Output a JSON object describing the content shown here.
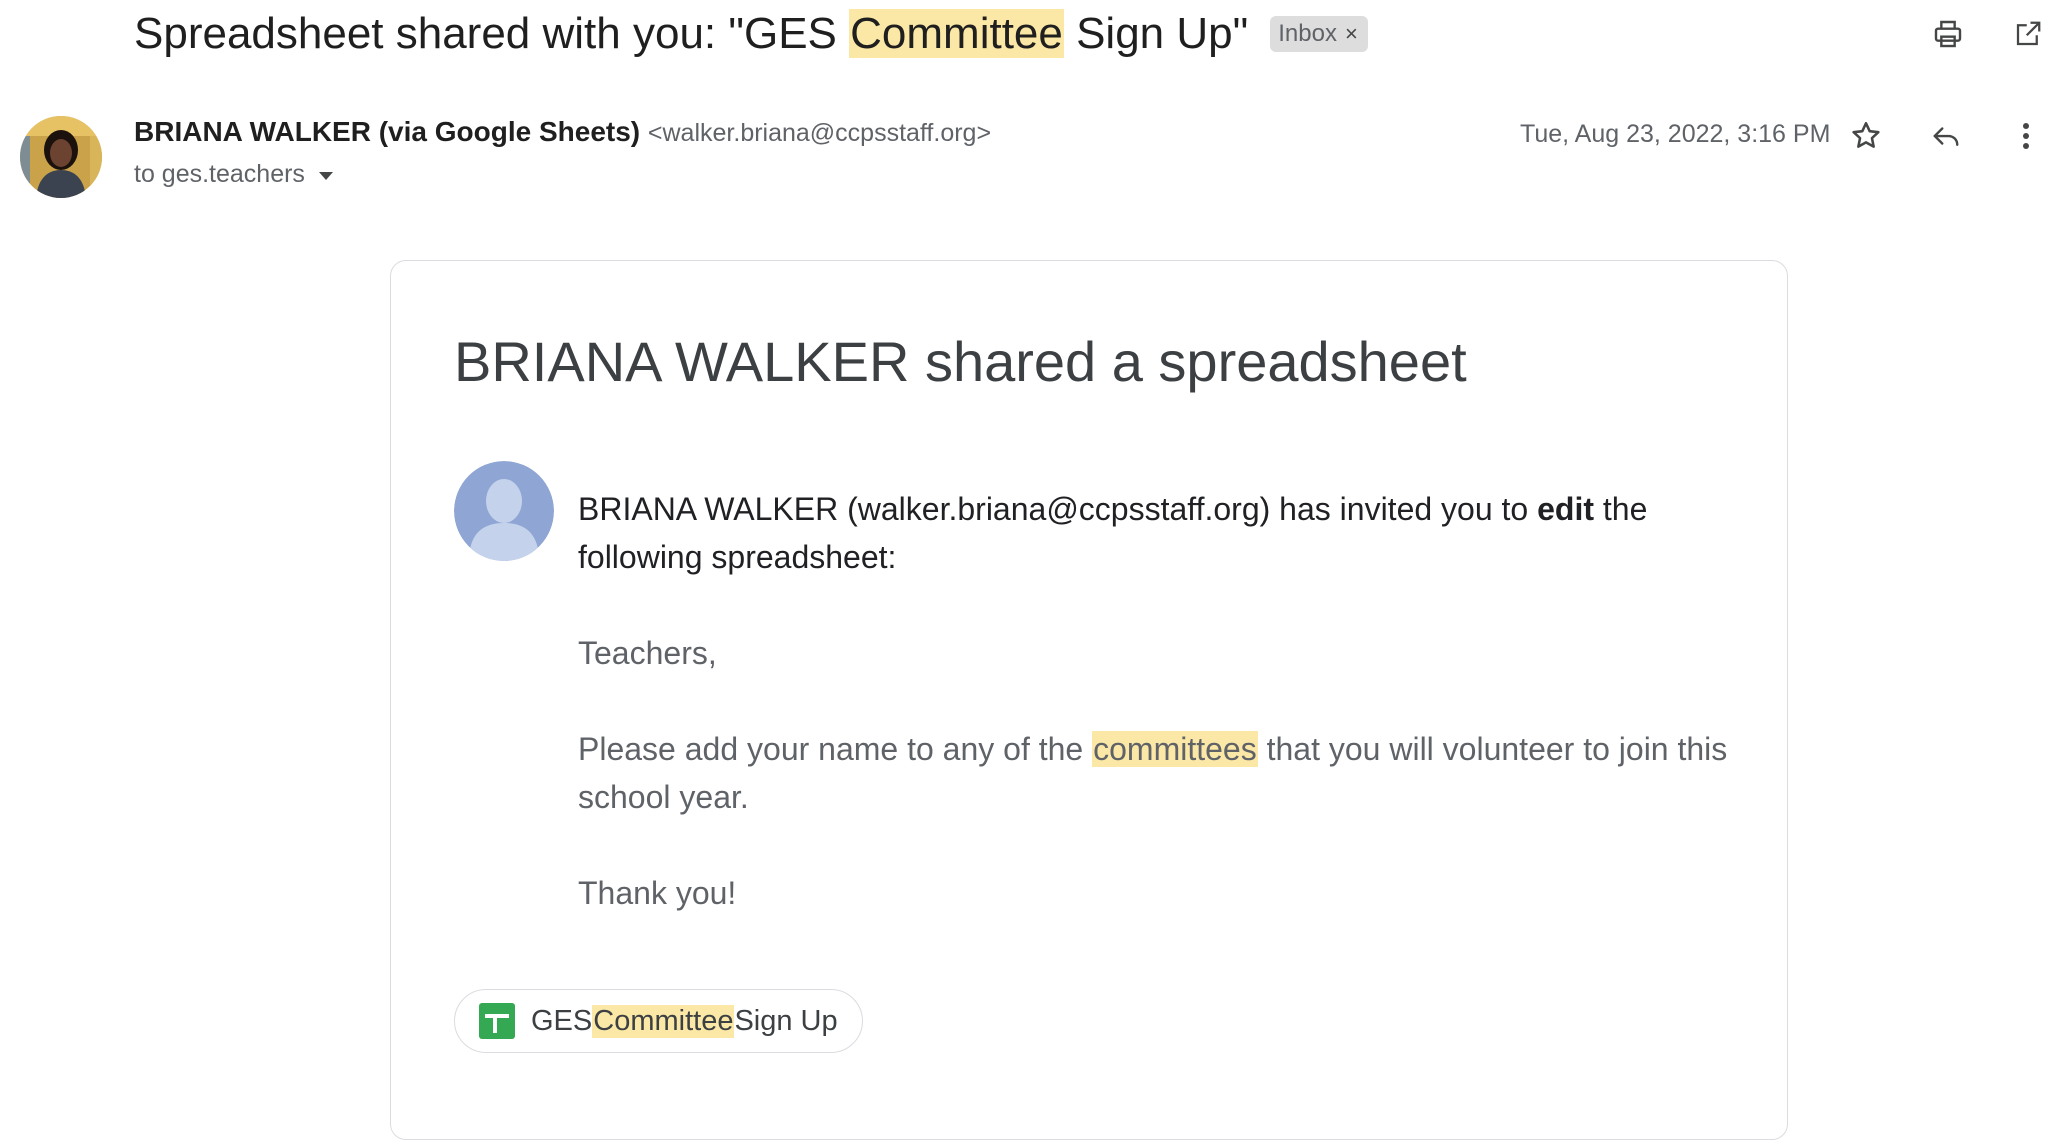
{
  "subject": {
    "prefix": "Spreadsheet shared with you: \"GES ",
    "highlight": "Committee",
    "suffix": " Sign Up\"",
    "label": "Inbox",
    "label_close": "×"
  },
  "sender": {
    "name": "BRIANA WALKER (via Google Sheets)",
    "email": "<walker.briana@ccpsstaff.org>",
    "to": "to ges.teachers",
    "date": "Tue, Aug 23, 2022, 3:16 PM"
  },
  "card": {
    "title": "BRIANA WALKER shared a spreadsheet",
    "invite_before": "BRIANA WALKER (walker.briana@ccpsstaff.org) has invited you to ",
    "invite_bold": "edit",
    "invite_after": " the following spreadsheet:",
    "greeting": "Teachers,",
    "body_before": "Please add your name to any of the ",
    "body_highlight": "committees",
    "body_after": " that you will volunteer to join this school year.",
    "closing": "Thank you!",
    "file_prefix": "GES ",
    "file_highlight": "Committee",
    "file_suffix": " Sign Up"
  },
  "icons": {
    "print": "print-icon",
    "open_new_window": "open-in-new-icon",
    "star": "star-icon",
    "reply": "reply-icon",
    "more": "more-vert-icon",
    "dropdown": "caret-down-icon",
    "sheets": "google-sheets-icon"
  },
  "colors": {
    "highlight": "#fce8a6",
    "sheets_green": "#34a853",
    "avatar_blue": "#8fa6d4"
  }
}
